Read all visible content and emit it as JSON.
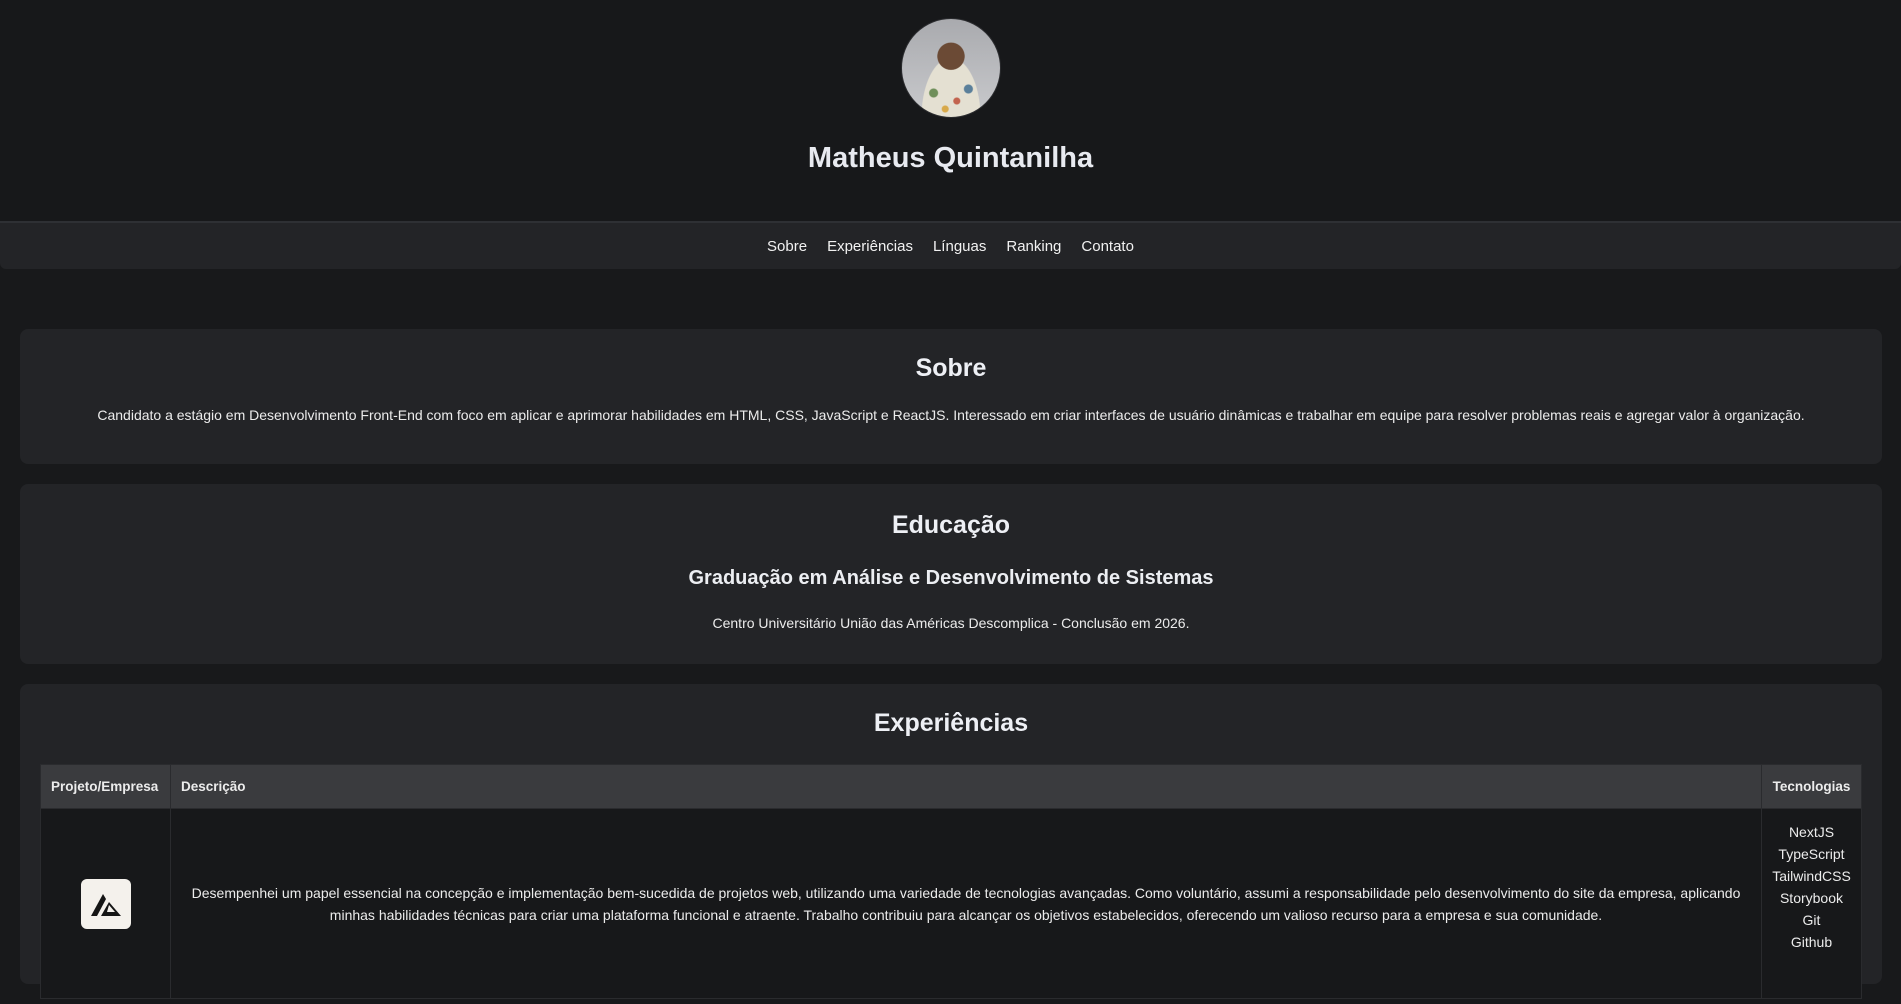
{
  "header": {
    "name": "Matheus Quintanilha",
    "avatar_icon": "profile-photo"
  },
  "nav": {
    "items": [
      "Sobre",
      "Experiências",
      "Línguas",
      "Ranking",
      "Contato"
    ]
  },
  "sobre": {
    "title": "Sobre",
    "text": "Candidato a estágio em Desenvolvimento Front-End com foco em aplicar e aprimorar habilidades em HTML, CSS, JavaScript e ReactJS. Interessado em criar interfaces de usuário dinâmicas e trabalhar em equipe para resolver problemas reais e agregar valor à organização."
  },
  "educacao": {
    "title": "Educação",
    "degree": "Graduação em Análise e Desenvolvimento de Sistemas",
    "institution": "Centro Universitário União das Américas Descomplica - Conclusão em 2026."
  },
  "experiencias": {
    "title": "Experiências",
    "columns": {
      "project": "Projeto/Empresa",
      "description": "Descrição",
      "technologies": "Tecnologias"
    },
    "rows": [
      {
        "logo_icon": "company-logo-icon",
        "description": "Desempenhei um papel essencial na concepção e implementação bem-sucedida de projetos web, utilizando uma variedade de tecnologias avançadas. Como voluntário, assumi a responsabilidade pelo desenvolvimento do site da empresa, aplicando minhas habilidades técnicas para criar uma plataforma funcional e atraente. Trabalho contribuiu para alcançar os objetivos estabelecidos, oferecendo um valioso recurso para a empresa e sua comunidade.",
        "technologies": [
          "NextJS",
          "TypeScript",
          "TailwindCSS",
          "Storybook",
          "Git",
          "Github"
        ]
      }
    ]
  },
  "colors": {
    "background": "#18191b",
    "card": "#232427",
    "table_header": "#3a3b3e",
    "text": "#ececec"
  }
}
